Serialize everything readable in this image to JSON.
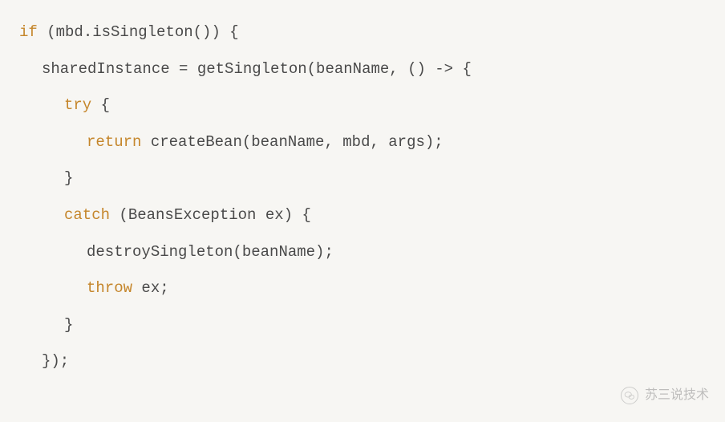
{
  "code": {
    "l1_kw": "if",
    "l1_rest": " (mbd.isSingleton()) {",
    "l2": "sharedInstance = getSingleton(beanName, () -> {",
    "l3_kw": "try",
    "l3_rest": " {",
    "l4_kw": "return",
    "l4_rest": " createBean(beanName, mbd, args);",
    "l5": "}",
    "l6_kw": "catch",
    "l6_rest": " (BeansException ex) {",
    "l7": "destroySingleton(beanName);",
    "l8_kw": "throw",
    "l8_rest": " ex;",
    "l9": "}",
    "l10": "});"
  },
  "watermark": {
    "text": "苏三说技术"
  }
}
